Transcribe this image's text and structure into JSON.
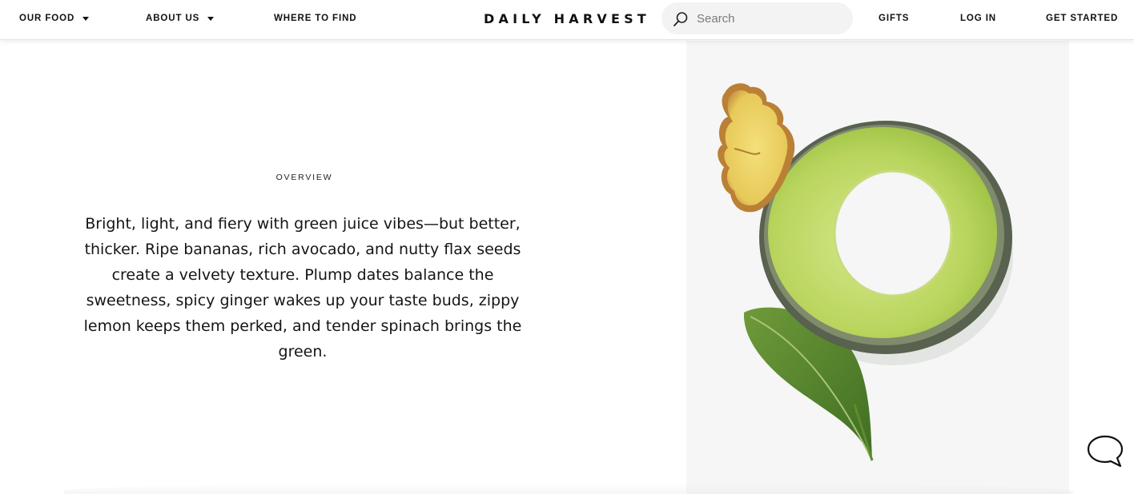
{
  "header": {
    "nav_left": [
      {
        "label": "OUR FOOD",
        "has_dropdown": true
      },
      {
        "label": "ABOUT US",
        "has_dropdown": true
      },
      {
        "label": "WHERE TO FIND",
        "has_dropdown": false
      }
    ],
    "logo": "DAILY HARVEST",
    "search": {
      "placeholder": "Search",
      "value": "",
      "icon": "search-icon"
    },
    "nav_right": [
      {
        "label": "GIFTS"
      },
      {
        "label": "LOG IN"
      },
      {
        "label": "GET STARTED"
      }
    ]
  },
  "overview": {
    "label": "OVERVIEW",
    "description": "Bright, light, and fiery with green juice vibes—but better, thicker. Ripe bananas, rich avocado, and nutty flax seeds create a velvety texture. Plump dates balance the sweetness, spicy ginger wakes up your taste buds, zippy lemon keeps them perked, and tender spinach brings the green."
  },
  "image": {
    "panel_color": "#f5f6f5"
  },
  "chat": {
    "icon": "chat-bubble-icon"
  }
}
